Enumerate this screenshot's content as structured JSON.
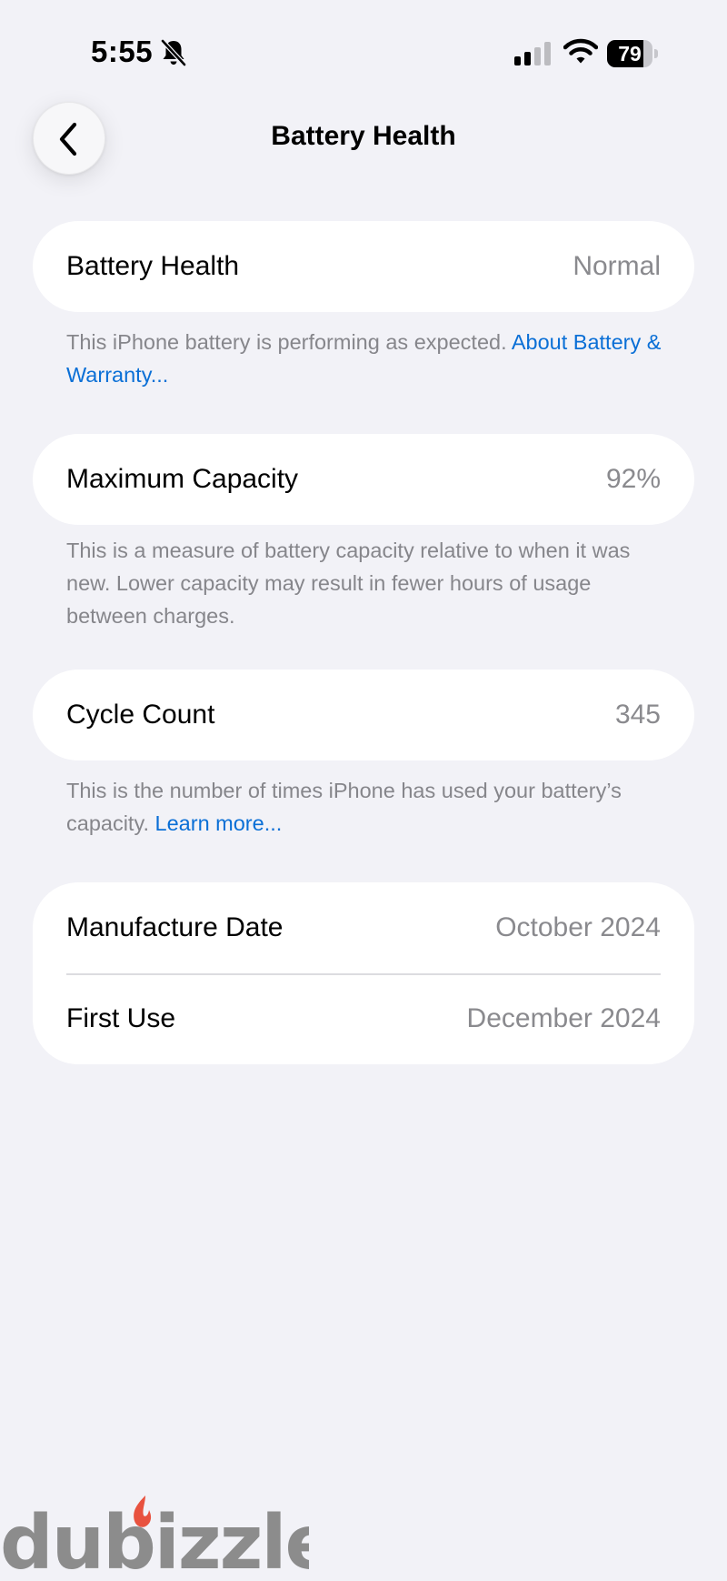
{
  "status_bar": {
    "time": "5:55",
    "battery_level": "79",
    "battery_fraction": 0.79,
    "icons": [
      "bell-slash-icon",
      "cellular-signal-icon",
      "wifi-icon",
      "battery-icon"
    ]
  },
  "nav": {
    "back_icon": "chevron-left-icon",
    "title": "Battery Health"
  },
  "sections": {
    "health": {
      "label": "Battery Health",
      "value": "Normal",
      "footnote_text": "This iPhone battery is performing as expected. ",
      "footnote_link": "About Battery & Warranty..."
    },
    "capacity": {
      "label": "Maximum Capacity",
      "value": "92%",
      "footnote_text": "This is a measure of battery capacity relative to when it was new. Lower capacity may result in fewer hours of usage between charges."
    },
    "cycles": {
      "label": "Cycle Count",
      "value": "345",
      "footnote_text": "This is the number of times iPhone has used your battery’s capacity. ",
      "footnote_link": "Learn more..."
    },
    "dates": {
      "manufacture_label": "Manufacture Date",
      "manufacture_value": "October 2024",
      "first_use_label": "First Use",
      "first_use_value": "December 2024"
    }
  },
  "watermark": {
    "text": "dubizzle",
    "flame_color": "#e8523f",
    "text_color": "#8c8c8c"
  },
  "colors": {
    "background": "#f2f2f7",
    "card": "#ffffff",
    "secondary_text": "#8a8a8e",
    "link": "#0a6fd6"
  }
}
